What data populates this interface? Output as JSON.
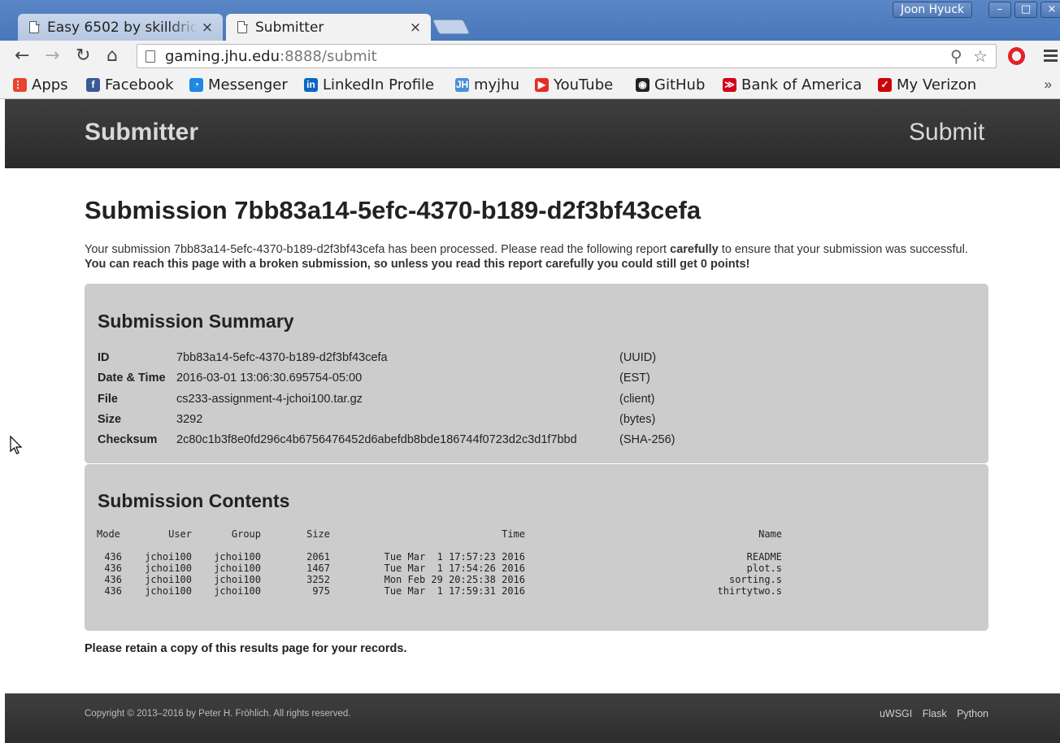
{
  "browser": {
    "tabs": [
      {
        "title": "Easy 6502 by skilldric",
        "close": "×",
        "active": false
      },
      {
        "title": "Submitter",
        "close": "×",
        "active": true
      }
    ],
    "user": "Joon Hyuck",
    "window_buttons": [
      "–",
      "□",
      "×"
    ],
    "url_host": "gaming.jhu.edu",
    "url_rest": ":8888/submit",
    "bookmarks": [
      {
        "label": "Apps",
        "icon": "apps-grid-icon",
        "color": "#e6442e"
      },
      {
        "label": "Facebook",
        "icon": "facebook-icon",
        "color": "#3b5998"
      },
      {
        "label": "Messenger",
        "icon": "messenger-icon",
        "color": "#1e88e5"
      },
      {
        "label": "LinkedIn Profile",
        "icon": "linkedin-icon",
        "color": "#0a66c2"
      },
      {
        "label": "myjhu",
        "icon": "jh-icon",
        "color": "#4a90d9"
      },
      {
        "label": "YouTube",
        "icon": "youtube-icon",
        "color": "#e52d27"
      },
      {
        "label": "GitHub",
        "icon": "github-icon",
        "color": "#222222"
      },
      {
        "label": "Bank of America",
        "icon": "bofa-icon",
        "color": "#d4001a"
      },
      {
        "label": "My Verizon",
        "icon": "verizon-icon",
        "color": "#cd040b"
      }
    ],
    "bookmarks_more": "»"
  },
  "site": {
    "brand": "Submitter",
    "nav_submit": "Submit"
  },
  "page": {
    "heading": "Submission 7bb83a14-5efc-4370-b189-d2f3bf43cefa",
    "intro_1": "Your submission 7bb83a14-5efc-4370-b189-d2f3bf43cefa has been processed. Please read the following report ",
    "intro_bold_1": "carefully",
    "intro_2": " to ensure that your submission was successful. ",
    "intro_bold_2": "You can reach this page with a broken submission, so unless you read this report carefully you could still get 0 points!",
    "retain": "Please retain a copy of this results page for your records."
  },
  "summary": {
    "title": "Submission Summary",
    "rows": [
      {
        "key": "ID",
        "value": "7bb83a14-5efc-4370-b189-d2f3bf43cefa",
        "unit": "(UUID)"
      },
      {
        "key": "Date & Time",
        "value": "2016-03-01 13:06:30.695754-05:00",
        "unit": "(EST)"
      },
      {
        "key": "File",
        "value": "cs233-assignment-4-jchoi100.tar.gz",
        "unit": "(client)"
      },
      {
        "key": "Size",
        "value": "3292",
        "unit": "(bytes)"
      },
      {
        "key": "Checksum",
        "value": "2c80c1b3f8e0fd296c4b6756476452d6abefdb8bde186744f0723d2c3d1f7bbd",
        "unit": "(SHA-256)"
      }
    ]
  },
  "contents": {
    "title": "Submission Contents",
    "headers": {
      "mode": "Mode",
      "user": "User",
      "group": "Group",
      "size": "Size",
      "time": "Time",
      "name": "Name"
    },
    "rows": [
      {
        "mode": "436",
        "user": "jchoi100",
        "group": "jchoi100",
        "size": "2061",
        "time": "Tue Mar  1 17:57:23 2016",
        "name": "README"
      },
      {
        "mode": "436",
        "user": "jchoi100",
        "group": "jchoi100",
        "size": "1467",
        "time": "Tue Mar  1 17:54:26 2016",
        "name": "plot.s"
      },
      {
        "mode": "436",
        "user": "jchoi100",
        "group": "jchoi100",
        "size": "3252",
        "time": "Mon Feb 29 20:25:38 2016",
        "name": "sorting.s"
      },
      {
        "mode": "436",
        "user": "jchoi100",
        "group": "jchoi100",
        "size": "975",
        "time": "Tue Mar  1 17:59:31 2016",
        "name": "thirtytwo.s"
      }
    ]
  },
  "footer": {
    "copyright": "Copyright © 2013–2016 by Peter H. Fröhlich. All rights reserved.",
    "links": [
      "uWSGI",
      "Flask",
      "Python"
    ]
  }
}
